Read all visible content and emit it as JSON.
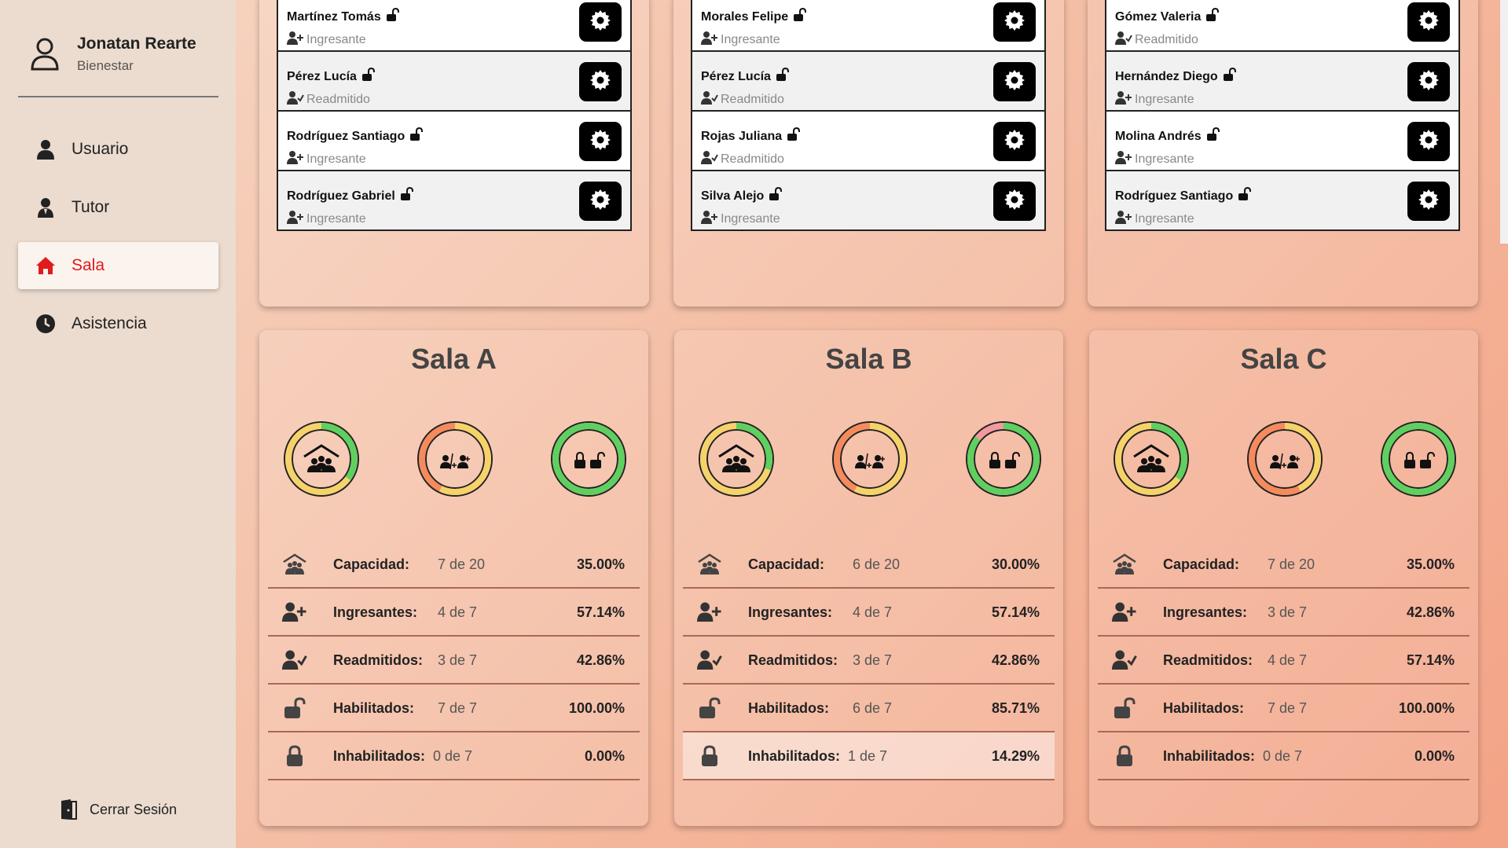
{
  "user": {
    "name": "Jonatan Rearte",
    "role": "Bienestar"
  },
  "nav": [
    {
      "label": "Usuario",
      "icon": "user-icon"
    },
    {
      "label": "Tutor",
      "icon": "tutor-icon"
    },
    {
      "label": "Sala",
      "icon": "home-icon",
      "active": true
    },
    {
      "label": "Asistencia",
      "icon": "clock-icon"
    }
  ],
  "logout_label": "Cerrar Sesión",
  "colors": {
    "accent": "#e01b1b",
    "green": "#5fd05f",
    "yellow": "#f6d26a",
    "orange": "#f58a5d",
    "pink": "#f39aa0"
  },
  "lists": [
    {
      "rows": [
        {
          "name": "Martínez Tomás",
          "status": "Ingresante",
          "status_icon": "user-plus-icon",
          "lock": "unlocked"
        },
        {
          "name": "Pérez Lucía",
          "status": "Readmitido",
          "status_icon": "user-check-icon",
          "lock": "unlocked"
        },
        {
          "name": "Rodríguez Santiago",
          "status": "Ingresante",
          "status_icon": "user-plus-icon",
          "lock": "unlocked"
        },
        {
          "name": "Rodríguez Gabriel",
          "status": "Ingresante",
          "status_icon": "user-plus-icon",
          "lock": "unlocked"
        }
      ]
    },
    {
      "rows": [
        {
          "name": "Morales Felipe",
          "status": "Ingresante",
          "status_icon": "user-plus-icon",
          "lock": "unlocked"
        },
        {
          "name": "Pérez Lucía",
          "status": "Readmitido",
          "status_icon": "user-check-icon",
          "lock": "unlocked"
        },
        {
          "name": "Rojas Juliana",
          "status": "Readmitido",
          "status_icon": "user-check-icon",
          "lock": "unlocked"
        },
        {
          "name": "Silva Alejo",
          "status": "Ingresante",
          "status_icon": "user-plus-icon",
          "lock": "unlocked"
        }
      ]
    },
    {
      "rows": [
        {
          "name": "Gómez Valeria",
          "status": "Readmitido",
          "status_icon": "user-check-icon",
          "lock": "unlocked"
        },
        {
          "name": "Hernández Diego",
          "status": "Ingresante",
          "status_icon": "user-plus-icon",
          "lock": "unlocked"
        },
        {
          "name": "Molina Andrés",
          "status": "Ingresante",
          "status_icon": "user-plus-icon",
          "lock": "unlocked"
        },
        {
          "name": "Rodríguez Santiago",
          "status": "Ingresante",
          "status_icon": "user-plus-icon",
          "lock": "unlocked"
        }
      ]
    }
  ],
  "salas": [
    {
      "title": "Sala A",
      "donuts": {
        "capacity": 0.35,
        "ingresantes": 0.5714,
        "habilitados": 1.0
      },
      "stats": [
        {
          "label": "Capacidad:",
          "value": "7 de 20",
          "pct": "35.00%",
          "icon": "building-people-icon"
        },
        {
          "label": "Ingresantes:",
          "value": "4 de 7",
          "pct": "57.14%",
          "icon": "user-plus-icon"
        },
        {
          "label": "Readmitidos:",
          "value": "3 de 7",
          "pct": "42.86%",
          "icon": "user-check-icon"
        },
        {
          "label": "Habilitados:",
          "value": "7 de 7",
          "pct": "100.00%",
          "icon": "unlock-icon"
        },
        {
          "label": "Inhabilitados:",
          "value": "0 de 7",
          "pct": "0.00%",
          "icon": "lock-icon"
        }
      ]
    },
    {
      "title": "Sala B",
      "donuts": {
        "capacity": 0.3,
        "ingresantes": 0.5714,
        "habilitados": 0.8571
      },
      "stats": [
        {
          "label": "Capacidad:",
          "value": "6 de 20",
          "pct": "30.00%",
          "icon": "building-people-icon"
        },
        {
          "label": "Ingresantes:",
          "value": "4 de 7",
          "pct": "57.14%",
          "icon": "user-plus-icon"
        },
        {
          "label": "Readmitidos:",
          "value": "3 de 7",
          "pct": "42.86%",
          "icon": "user-check-icon"
        },
        {
          "label": "Habilitados:",
          "value": "6 de 7",
          "pct": "85.71%",
          "icon": "unlock-icon"
        },
        {
          "label": "Inhabilitados:",
          "value": "1 de 7",
          "pct": "14.29%",
          "icon": "lock-icon",
          "highlight": true
        }
      ]
    },
    {
      "title": "Sala C",
      "donuts": {
        "capacity": 0.35,
        "ingresantes": 0.4286,
        "habilitados": 1.0
      },
      "stats": [
        {
          "label": "Capacidad:",
          "value": "7 de 20",
          "pct": "35.00%",
          "icon": "building-people-icon"
        },
        {
          "label": "Ingresantes:",
          "value": "3 de 7",
          "pct": "42.86%",
          "icon": "user-plus-icon"
        },
        {
          "label": "Readmitidos:",
          "value": "4 de 7",
          "pct": "57.14%",
          "icon": "user-check-icon"
        },
        {
          "label": "Habilitados:",
          "value": "7 de 7",
          "pct": "100.00%",
          "icon": "unlock-icon"
        },
        {
          "label": "Inhabilitados:",
          "value": "0 de 7",
          "pct": "0.00%",
          "icon": "lock-icon"
        }
      ]
    }
  ]
}
